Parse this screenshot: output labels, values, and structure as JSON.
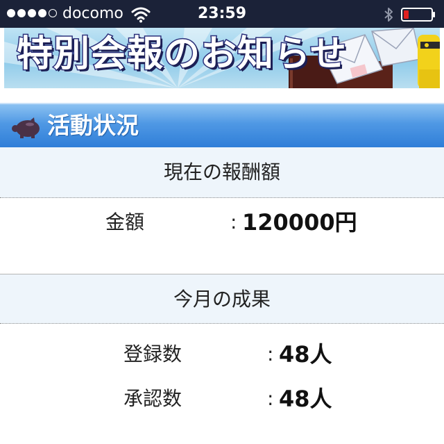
{
  "status_bar": {
    "carrier": "docomo",
    "time": "23:59",
    "signal_icon": "signal-dots-icon",
    "wifi_icon": "wifi-icon",
    "bluetooth_icon": "bluetooth-icon",
    "battery_icon": "battery-icon",
    "battery_color": "#e02020"
  },
  "banner": {
    "title": "特別会報のお知らせ"
  },
  "activity": {
    "title": "活動状況",
    "icon": "piggy-bank-icon",
    "header_color": "#3d8ddf",
    "reward": {
      "heading": "現在の報酬額",
      "label": "金額",
      "colon": ":",
      "value": "120000円"
    },
    "monthly": {
      "heading": "今月の成果",
      "rows": [
        {
          "label": "登録数",
          "colon": ":",
          "value": "48人"
        },
        {
          "label": "承認数",
          "colon": ":",
          "value": "48人"
        }
      ]
    }
  }
}
